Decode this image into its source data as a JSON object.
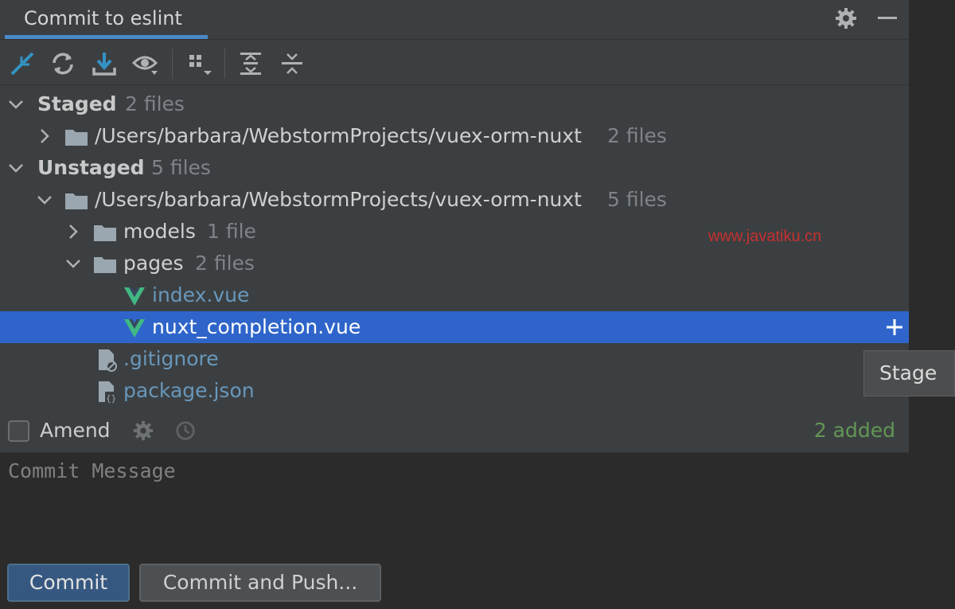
{
  "header": {
    "tab_title": "Commit to eslint",
    "icons": [
      "gear-icon",
      "minimize-icon"
    ]
  },
  "toolbar": {
    "icons": [
      "rollback-icon",
      "refresh-icon",
      "update-icon",
      "show-diff-icon",
      "group-by-icon",
      "expand-all-icon",
      "collapse-all-icon"
    ]
  },
  "tree": {
    "staged": {
      "label": "Staged",
      "count": "2 files",
      "path": "/Users/barbara/WebstormProjects/vuex-orm-nuxt",
      "path_count": "2 files"
    },
    "unstaged": {
      "label": "Unstaged",
      "count": "5 files",
      "path": "/Users/barbara/WebstormProjects/vuex-orm-nuxt",
      "path_count": "5 files",
      "models": {
        "label": "models",
        "count": "1 file"
      },
      "pages": {
        "label": "pages",
        "count": "2 files"
      },
      "files": [
        "index.vue",
        "nuxt_completion.vue",
        ".gitignore",
        "package.json"
      ]
    }
  },
  "tooltip": "Stage",
  "watermark": "www.javatiku.cn",
  "amend": {
    "label": "Amend",
    "checked": false,
    "added_status": "2 added"
  },
  "message": {
    "placeholder": "Commit Message"
  },
  "buttons": {
    "commit": "Commit",
    "commit_push": "Commit and Push..."
  },
  "colors": {
    "panel_bg": "#3c3f41",
    "selection": "#2f65ca",
    "accent": "#4a88c7",
    "vue_green": "#41b883",
    "added_green": "#629755",
    "file_blue": "#6897bb"
  }
}
